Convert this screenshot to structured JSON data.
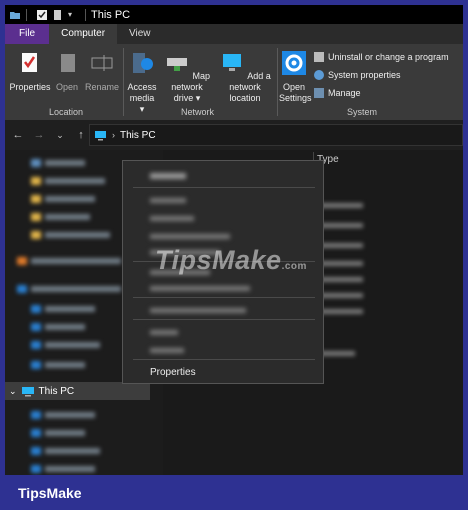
{
  "window": {
    "title": "This PC"
  },
  "tabs": [
    {
      "label": "File"
    },
    {
      "label": "Computer"
    },
    {
      "label": "View"
    }
  ],
  "ribbon": {
    "location": {
      "label": "Location",
      "buttons": [
        {
          "label": "Properties",
          "icon": "properties-icon"
        },
        {
          "label": "Open",
          "icon": "open-icon"
        },
        {
          "label": "Rename",
          "icon": "rename-icon"
        }
      ]
    },
    "network": {
      "label": "Network",
      "buttons": [
        {
          "label1": "Access",
          "label2": "media",
          "icon": "media-icon"
        },
        {
          "label1": "Map network",
          "label2": "drive",
          "icon": "network-drive-icon"
        },
        {
          "label1": "Add a network",
          "label2": "location",
          "icon": "network-location-icon"
        }
      ]
    },
    "system": {
      "label": "System",
      "open_settings_1": "Open",
      "open_settings_2": "Settings",
      "items": [
        {
          "label": "Uninstall or change a program"
        },
        {
          "label": "System properties"
        },
        {
          "label": "Manage"
        }
      ]
    }
  },
  "address": {
    "path": "This PC"
  },
  "nav_pane": {
    "selected": "This PC"
  },
  "content": {
    "column_type": "Type"
  },
  "context_menu": {
    "properties": "Properties"
  },
  "watermark": {
    "text": "TipsMake",
    "suffix": ".com"
  },
  "footer": {
    "brand": "TipsMake"
  },
  "colors": {
    "file_tab": "#5b2f8f",
    "accent_blue": "#1e88e5",
    "frame": "#2e3192"
  }
}
